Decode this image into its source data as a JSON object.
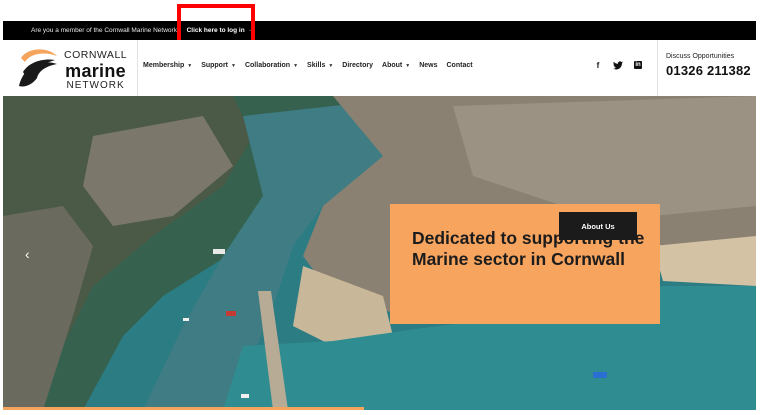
{
  "topbar": {
    "message": "Are you a member of the Cornwall Marine Network?",
    "login_link": "Click here to log in",
    "arrow": "→"
  },
  "logo": {
    "line1": "CORNWALL",
    "line2": "marine",
    "line3": "NETWORK",
    "mark_colors": {
      "primary": "#1a1a1a",
      "accent": "#f4a45c"
    }
  },
  "nav": {
    "items": [
      {
        "label": "Membership",
        "has_dropdown": true
      },
      {
        "label": "Support",
        "has_dropdown": true
      },
      {
        "label": "Collaboration",
        "has_dropdown": true
      },
      {
        "label": "Skills",
        "has_dropdown": true
      },
      {
        "label": "Directory",
        "has_dropdown": false
      },
      {
        "label": "About",
        "has_dropdown": true
      },
      {
        "label": "News",
        "has_dropdown": false
      },
      {
        "label": "Contact",
        "has_dropdown": false
      }
    ],
    "caret": "▼"
  },
  "social": {
    "facebook": "f",
    "twitter": "𝕏",
    "linkedin": "in",
    "icons": [
      "facebook-icon",
      "twitter-icon",
      "linkedin-icon"
    ]
  },
  "contact": {
    "label": "Discuss Opportunities",
    "phone": "01326 211382"
  },
  "hero": {
    "prev_arrow": "‹",
    "headline": "Dedicated to supporting the Marine sector in Cornwall",
    "button_label": "About Us",
    "progress": 0.48,
    "colors": {
      "card": "#f7a45e",
      "button": "#1b1b1b",
      "progress": "#f4a45c"
    }
  }
}
